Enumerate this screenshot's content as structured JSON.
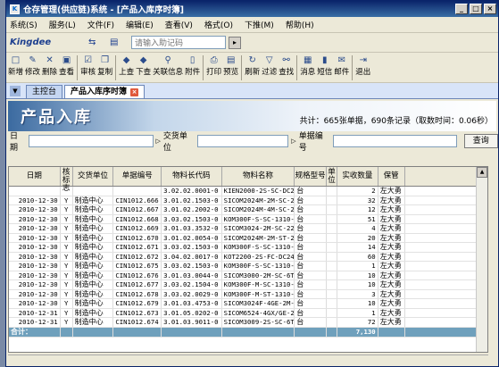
{
  "window": {
    "title": "仓存管理(供应链)系统 - [产品入库序时簿]",
    "controls": [
      "_",
      "□",
      "×"
    ]
  },
  "menu": [
    "系统(S)",
    "服务(L)",
    "文件(F)",
    "编辑(E)",
    "查看(V)",
    "格式(O)",
    "下推(M)",
    "帮助(H)"
  ],
  "address": {
    "logo": "Kingdee",
    "placeholder": "请输入助记码"
  },
  "toolbar": [
    {
      "label": "新增",
      "icon": "new-icon"
    },
    {
      "label": "修改",
      "icon": "edit-icon"
    },
    {
      "label": "删除",
      "icon": "delete-icon"
    },
    {
      "label": "查看",
      "icon": "view-icon"
    },
    {
      "label": "审核",
      "icon": "audit-icon"
    },
    {
      "label": "复制",
      "icon": "copy-icon"
    },
    {
      "label": "上查",
      "icon": "up-query-icon"
    },
    {
      "label": "下查",
      "icon": "down-query-icon"
    },
    {
      "label": "关联信息",
      "icon": "link-info-icon"
    },
    {
      "label": "附件",
      "icon": "attachment-icon"
    },
    {
      "label": "打印",
      "icon": "print-icon"
    },
    {
      "label": "预览",
      "icon": "preview-icon"
    },
    {
      "label": "刷新",
      "icon": "refresh-icon"
    },
    {
      "label": "过滤",
      "icon": "filter-icon"
    },
    {
      "label": "查找",
      "icon": "find-icon"
    },
    {
      "label": "消息",
      "icon": "message-icon"
    },
    {
      "label": "短信",
      "icon": "sms-icon"
    },
    {
      "label": "邮件",
      "icon": "mail-icon"
    },
    {
      "label": "退出",
      "icon": "exit-icon"
    }
  ],
  "tabs": [
    {
      "label": "主控台"
    },
    {
      "label": "产品入库序时簿"
    }
  ],
  "banner": {
    "title": "产品入库",
    "stats": "共计：665张单据，690条记录（取数时间：0.06秒）"
  },
  "filter": {
    "date_label": "日期",
    "unit_label": "交货单位",
    "billno_label": "单据编号",
    "query_label": "查询"
  },
  "grid": {
    "headers": [
      "日期",
      "审核标志",
      "交货单位",
      "单据编号",
      "物料长代码",
      "物料名称",
      "规格型号",
      "单位",
      "实收数量",
      "保管"
    ],
    "rows": [
      [
        "",
        "",
        "",
        "",
        "3.02.02.0001-0",
        "KIEN2000-2S-SC-DC24产成品-KI",
        "台",
        "",
        "2",
        "左大勇"
      ],
      [
        "2010-12-30",
        "Y",
        "制造中心",
        "CIN1012.666",
        "3.01.02.1503-0",
        "SICOM2024M-2M-SC-24产成品-SI",
        "台",
        "",
        "32",
        "左大勇"
      ],
      [
        "2010-12-30",
        "Y",
        "制造中心",
        "CIN1012.667",
        "3.01.02.2002-0",
        "SICOM2024M-4M-SC-24产成品-SI",
        "台",
        "",
        "12",
        "左大勇"
      ],
      [
        "2010-12-30",
        "Y",
        "制造中心",
        "CIN1012.668",
        "3.03.02.1503-0",
        "KOM300F-S-SC-1310-4产成品-KO",
        "台",
        "",
        "51",
        "左大勇"
      ],
      [
        "2010-12-30",
        "Y",
        "制造中心",
        "CIN1012.669",
        "3.01.03.3532-0",
        "SICOM3024-2M-SC-22T产成品-SI",
        "台",
        "",
        "4",
        "左大勇"
      ],
      [
        "2010-12-30",
        "Y",
        "制造中心",
        "CIN1012.670",
        "3.01.02.0054-0",
        "SICOM2024M-2M-ST-24产成品-SI",
        "台",
        "",
        "20",
        "左大勇"
      ],
      [
        "2010-12-30",
        "Y",
        "制造中心",
        "CIN1012.671",
        "3.03.02.1503-0",
        "KOM300F-S-SC-1310-4产成品-KO",
        "台",
        "",
        "14",
        "左大勇"
      ],
      [
        "2010-12-30",
        "Y",
        "制造中心",
        "CIN1012.672",
        "3.04.02.0017-0",
        "KOT2200-2S-FC-DC24产成品-KO",
        "台",
        "",
        "60",
        "左大勇"
      ],
      [
        "2010-12-30",
        "Y",
        "制造中心",
        "CIN1012.675",
        "3.03.02.1503-0",
        "KOM300F-S-SC-1310-4产成品-KO",
        "台",
        "",
        "1",
        "左大勇"
      ],
      [
        "2010-12-30",
        "Y",
        "制造中心",
        "CIN1012.676",
        "3.01.03.0044-0",
        "SICOM3000-2M-SC-6T-产成品-SI",
        "台",
        "",
        "10",
        "左大勇"
      ],
      [
        "2010-12-30",
        "Y",
        "制造中心",
        "CIN1012.677",
        "3.03.02.1504-0",
        "KOM300F-M-SC-1310-5产成品-KO",
        "台",
        "",
        "10",
        "左大勇"
      ],
      [
        "2010-12-30",
        "Y",
        "制造中心",
        "CIN1012.678",
        "3.03.02.0029-0",
        "KOM300F-M-ST-1310-5产成品-KO",
        "台",
        "",
        "3",
        "左大勇"
      ],
      [
        "2010-12-30",
        "Y",
        "制造中心",
        "CIN1012.679",
        "3.01.03.4753-0",
        "SICOM3024F-4GE-2M-S产成品-SI",
        "台",
        "",
        "10",
        "左大勇"
      ],
      [
        "2010-12-31",
        "Y",
        "制造中心",
        "CIN1012.673",
        "3.01.05.0202-0",
        "SICOM6524-4GX/GE-20产成品-SI",
        "台",
        "",
        "1",
        "左大勇"
      ],
      [
        "2010-12-31",
        "Y",
        "制造中心",
        "CIN1012.674",
        "3.01.03.9011-0",
        "SICOM3009-2S-SC-6T-产成品-SI",
        "台",
        "",
        "72",
        "左大勇"
      ]
    ],
    "total_label": "合计：",
    "total_value": "7,130"
  }
}
